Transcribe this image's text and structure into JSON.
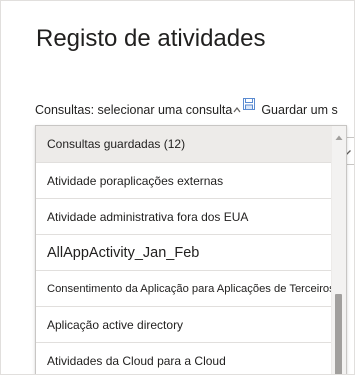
{
  "page": {
    "title": "Registo de atividades"
  },
  "query": {
    "label": "Consultas: selecionar uma consulta",
    "save_label": "Guardar um s"
  },
  "dropdown": {
    "options": [
      "Consultas guardadas (12)",
      "Atividade poraplicações externas",
      "Atividade administrativa fora dos EUA",
      "AllAppActivity_Jan_Feb",
      "Consentimento da Aplicação para Aplicações de Terceiros",
      "Aplicação active directory",
      "Atividades da Cloud para a Cloud"
    ]
  },
  "colors": {
    "text": "#201f1e",
    "selected_background": "#edebe9",
    "border": "#c8c6c4",
    "scroll_thumb": "#a19f9d",
    "save_icon": "#5b8bd1"
  },
  "icons": {
    "query_caret": "caret-up-icon",
    "save": "save-icon",
    "behind_select": "chevron-down-icon",
    "scroll_up": "scroll-up-arrow-icon"
  }
}
